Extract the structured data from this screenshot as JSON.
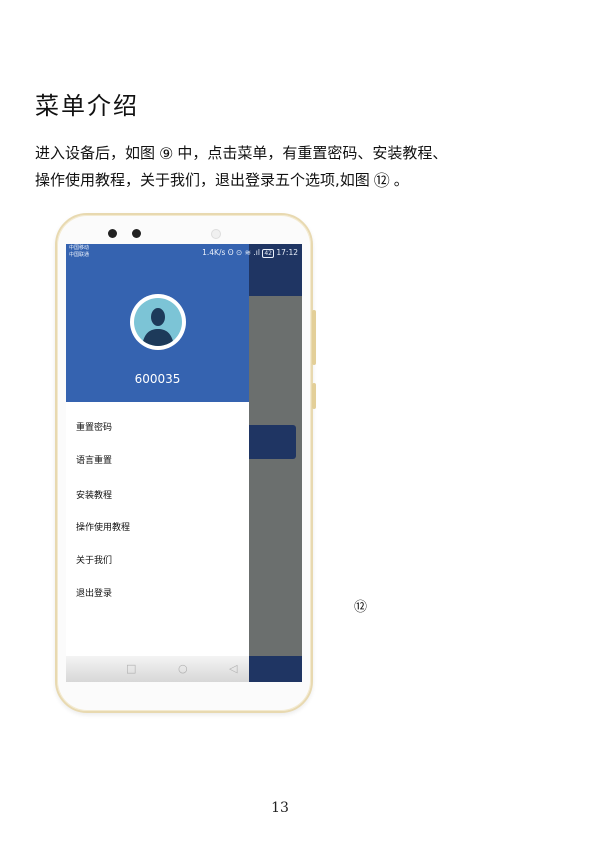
{
  "heading": "菜单介绍",
  "paragraph": {
    "line1_text": "进入设备后，如图",
    "line1_ref": "⑨",
    "line1_tail": "中，点击菜单，有重置密码、安装教程、",
    "line2_text": "操作使用教程，关于我们，退出登录五个选项,如图",
    "line2_ref": "⑫",
    "line2_tail": "。"
  },
  "phone": {
    "status_carrier_1": "中国移动",
    "status_carrier_2": "中国联通",
    "status_speed": "1.4K/s",
    "status_battery": "42",
    "status_time": "17:12",
    "username": "600035",
    "menu": [
      {
        "label": "重置密码"
      },
      {
        "label": "语言重置"
      },
      {
        "label": "安装教程"
      },
      {
        "label": "操作使用教程"
      },
      {
        "label": "关于我们"
      },
      {
        "label": "退出登录"
      }
    ],
    "icons": [
      "square-nav-icon",
      "circle-home-icon",
      "triangle-back-icon",
      "avatar-person-icon"
    ],
    "colors": {
      "drawer_header": "#3563b0",
      "app_bar": "#1f3563",
      "frame_gold": "#e8d9b0"
    }
  },
  "figure_number": "⑫",
  "page_number": "13"
}
